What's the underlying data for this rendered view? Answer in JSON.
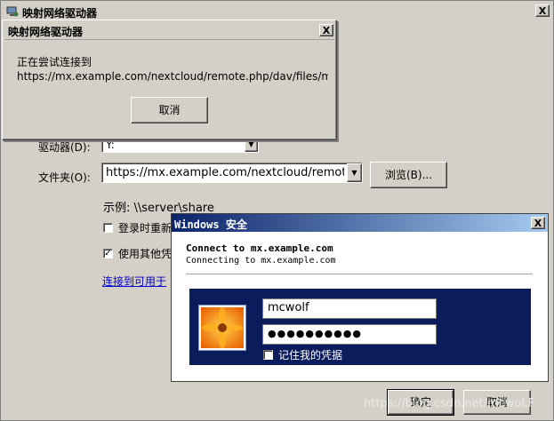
{
  "main": {
    "title": "映射网络驱动器",
    "close_label": "X",
    "drive_label": "驱动器(D):",
    "drive_value": "Y:",
    "folder_label": "文件夹(O):",
    "folder_value": "https://mx.example.com/nextcloud/remote.php",
    "browse_label": "浏览(B)...",
    "example_text": "示例: \\\\server\\share",
    "reconnect_label": "登录时重新",
    "other_creds_label": "使用其他凭",
    "link_text": "连接到可用于",
    "ok_label": "确定",
    "cancel_label": "取消"
  },
  "connecting": {
    "title": "映射网络驱动器",
    "close_label": "X",
    "status_line": "正在尝试连接到",
    "url_line": "https://mx.example.com/nextcloud/remote.php/dav/files/mc",
    "cancel_label": "取消"
  },
  "security": {
    "title_prefix": "Windows",
    "title_suffix": "安全",
    "close_label": "X",
    "connect_heading": "Connect to mx.example.com",
    "connect_sub": "Connecting to mx.example.com",
    "username": "mcwolf",
    "password_mask": "●●●●●●●●●●",
    "remember_label": "记住我的凭据"
  },
  "watermark": "https://blog.csdn.net/mcwoLF",
  "colors": {
    "title_blue": "#0a246a",
    "panel_blue": "#0b1c5c",
    "link": "#0000cc"
  }
}
